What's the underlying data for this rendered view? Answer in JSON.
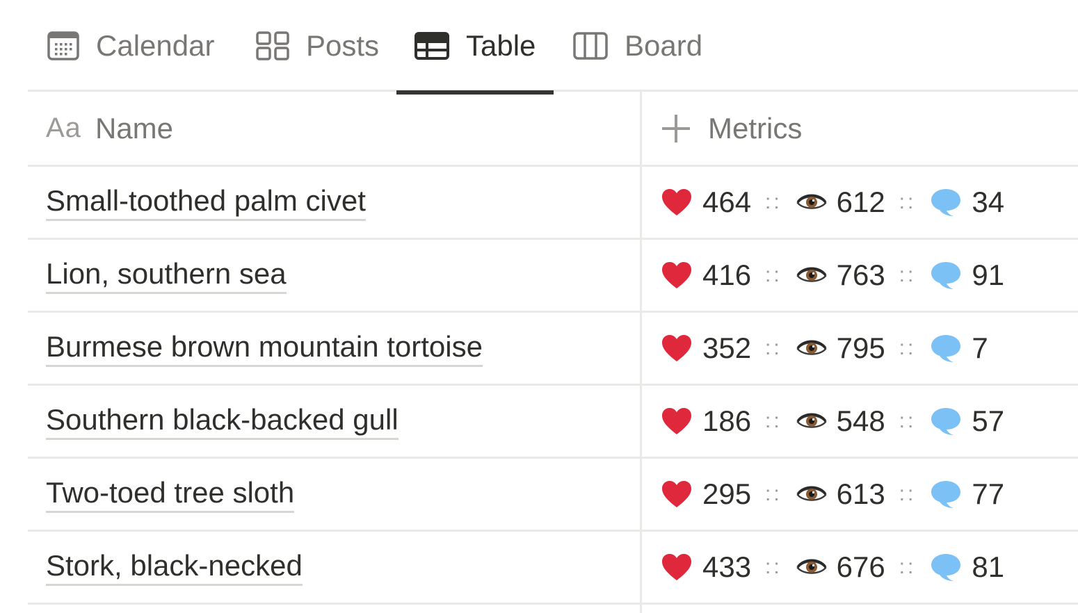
{
  "tabs": [
    {
      "label": "Calendar",
      "icon": "calendar-icon",
      "active": false
    },
    {
      "label": "Posts",
      "icon": "gallery-icon",
      "active": false
    },
    {
      "label": "Table",
      "icon": "table-icon",
      "active": true
    },
    {
      "label": "Board",
      "icon": "board-icon",
      "active": false
    }
  ],
  "table": {
    "columns": [
      {
        "label": "Name",
        "icon": "text-property-icon",
        "icon_text": "Aa"
      },
      {
        "label": "Metrics",
        "icon": "plus-icon"
      }
    ],
    "separator": "::",
    "rows": [
      {
        "name": "Small-toothed palm civet",
        "likes": "464",
        "views": "612",
        "comments": "34"
      },
      {
        "name": "Lion, southern sea",
        "likes": "416",
        "views": "763",
        "comments": "91"
      },
      {
        "name": "Burmese brown mountain tortoise",
        "likes": "352",
        "views": "795",
        "comments": "7"
      },
      {
        "name": "Southern black-backed gull",
        "likes": "186",
        "views": "548",
        "comments": "57"
      },
      {
        "name": "Two-toed tree sloth",
        "likes": "295",
        "views": "613",
        "comments": "77"
      },
      {
        "name": "Stork, black-necked",
        "likes": "433",
        "views": "676",
        "comments": "81"
      }
    ]
  },
  "colors": {
    "heart": "#e0283d",
    "comment_bubble": "#7cc1f5",
    "active_tab_underline": "#37352f",
    "divider": "#e9e9e7"
  }
}
